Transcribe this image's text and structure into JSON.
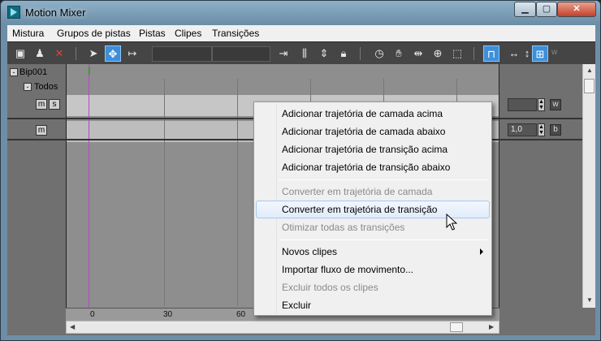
{
  "window": {
    "title": "Motion Mixer"
  },
  "caption": {
    "minimize": "▁",
    "maximize": "▢",
    "close": "✕"
  },
  "menubar": [
    "Mistura",
    "Grupos de pistas",
    "Pistas",
    "Clipes",
    "Transições"
  ],
  "toolbar": {
    "icons": [
      "add-trackgroup-icon",
      "add-biped-icon",
      "delete-icon",
      "select-icon",
      "move-icon",
      "slide-icon",
      "set-range-icon",
      "trim-icon",
      "fit-icon",
      "lock-icon",
      "time-slider-icon",
      "hand-pan-icon",
      "zoom-extents-icon",
      "zoom-icon",
      "region-zoom-icon",
      "snap-frames-icon",
      "horizontal-resize-icon",
      "vertical-resize-icon",
      "preview-icon"
    ],
    "trailing_label": "w"
  },
  "tracks": {
    "root_label": "Bip001",
    "group_label": "Todos",
    "row1_buttons": [
      "m",
      "s"
    ],
    "row2_buttons": [
      "m"
    ],
    "weight_value_1": "",
    "weight_value_2": "1,0",
    "row1_letter": "w",
    "row2_letter": "b"
  },
  "ruler": {
    "ticks": [
      "0",
      "30",
      "60"
    ]
  },
  "context_menu": {
    "groups": [
      [
        {
          "label": "Adicionar trajetória de camada acima",
          "enabled": true
        },
        {
          "label": "Adicionar trajetória de camada abaixo",
          "enabled": true
        },
        {
          "label": "Adicionar trajetória de transição acima",
          "enabled": true
        },
        {
          "label": "Adicionar trajetória de transição abaixo",
          "enabled": true
        }
      ],
      [
        {
          "label": "Converter em trajetória de camada",
          "enabled": false
        },
        {
          "label": "Converter em trajetória de transição",
          "enabled": true,
          "highlighted": true
        },
        {
          "label": "Otimizar todas as transições",
          "enabled": false
        }
      ],
      [
        {
          "label": "Novos clipes",
          "enabled": true,
          "submenu": true
        },
        {
          "label": "Importar fluxo de movimento...",
          "enabled": true
        },
        {
          "label": "Excluir todos os clipes",
          "enabled": false
        },
        {
          "label": "Excluir",
          "enabled": true
        }
      ]
    ]
  },
  "colors": {
    "highlight": "#e1ecfa",
    "toolbar_active": "#3f8fd8",
    "time_cursor": "#b04ad0"
  }
}
